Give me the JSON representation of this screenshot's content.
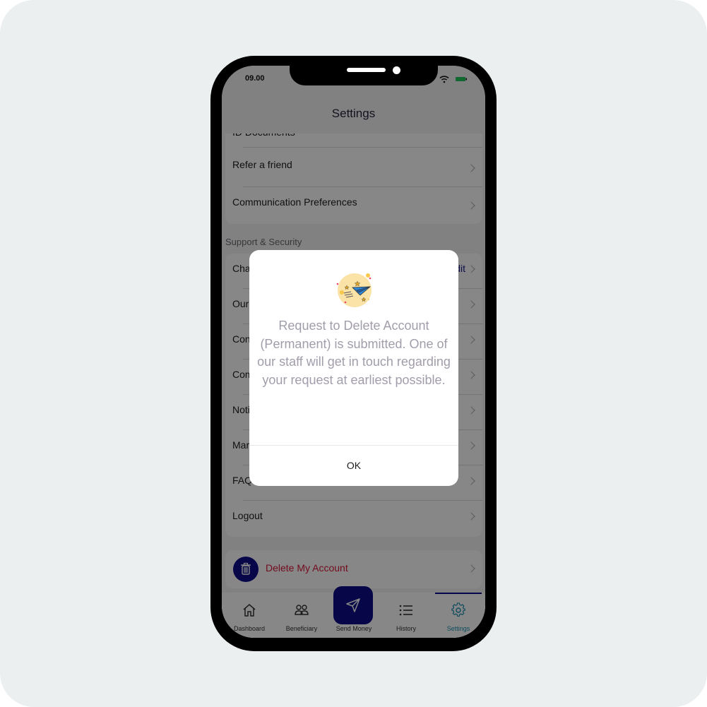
{
  "status_bar": {
    "time": "09.00",
    "wifi_icon": "wifi-icon",
    "battery_icon": "battery-icon",
    "battery_color": "#22c55e"
  },
  "header": {
    "title": "Settings"
  },
  "account_section": {
    "items": [
      {
        "label": "ID Documents"
      },
      {
        "label": "Refer a friend"
      },
      {
        "label": "Communication Preferences"
      }
    ]
  },
  "support_section": {
    "title": "Support & Security",
    "items": [
      {
        "label": "Change Password",
        "action": "Edit"
      },
      {
        "label": "Our Policies"
      },
      {
        "label": "Contact Us"
      },
      {
        "label": "Complaints"
      },
      {
        "label": "Notifications"
      },
      {
        "label": "Marketing Preferences"
      },
      {
        "label": "FAQs"
      },
      {
        "label": "Logout"
      }
    ]
  },
  "delete_account": {
    "label": "Delete My Account",
    "icon": "trash-icon",
    "color": "#d9183a"
  },
  "tab_bar": {
    "tabs": [
      {
        "label": "Dashboard",
        "icon": "home-icon"
      },
      {
        "label": "Beneficiary",
        "icon": "users-icon"
      },
      {
        "label": "Send Money",
        "icon": "send-icon"
      },
      {
        "label": "History",
        "icon": "list-icon"
      },
      {
        "label": "Settings",
        "icon": "gear-icon",
        "active": true
      }
    ],
    "accent": "#0c0c8a",
    "active_color": "#1b8fb3"
  },
  "dialog": {
    "icon": "paper-plane-icon",
    "message": "Request to Delete Account (Permanent) is submitted. One of our staff will get in touch regarding your request at earliest possible.",
    "ok_label": "OK"
  }
}
